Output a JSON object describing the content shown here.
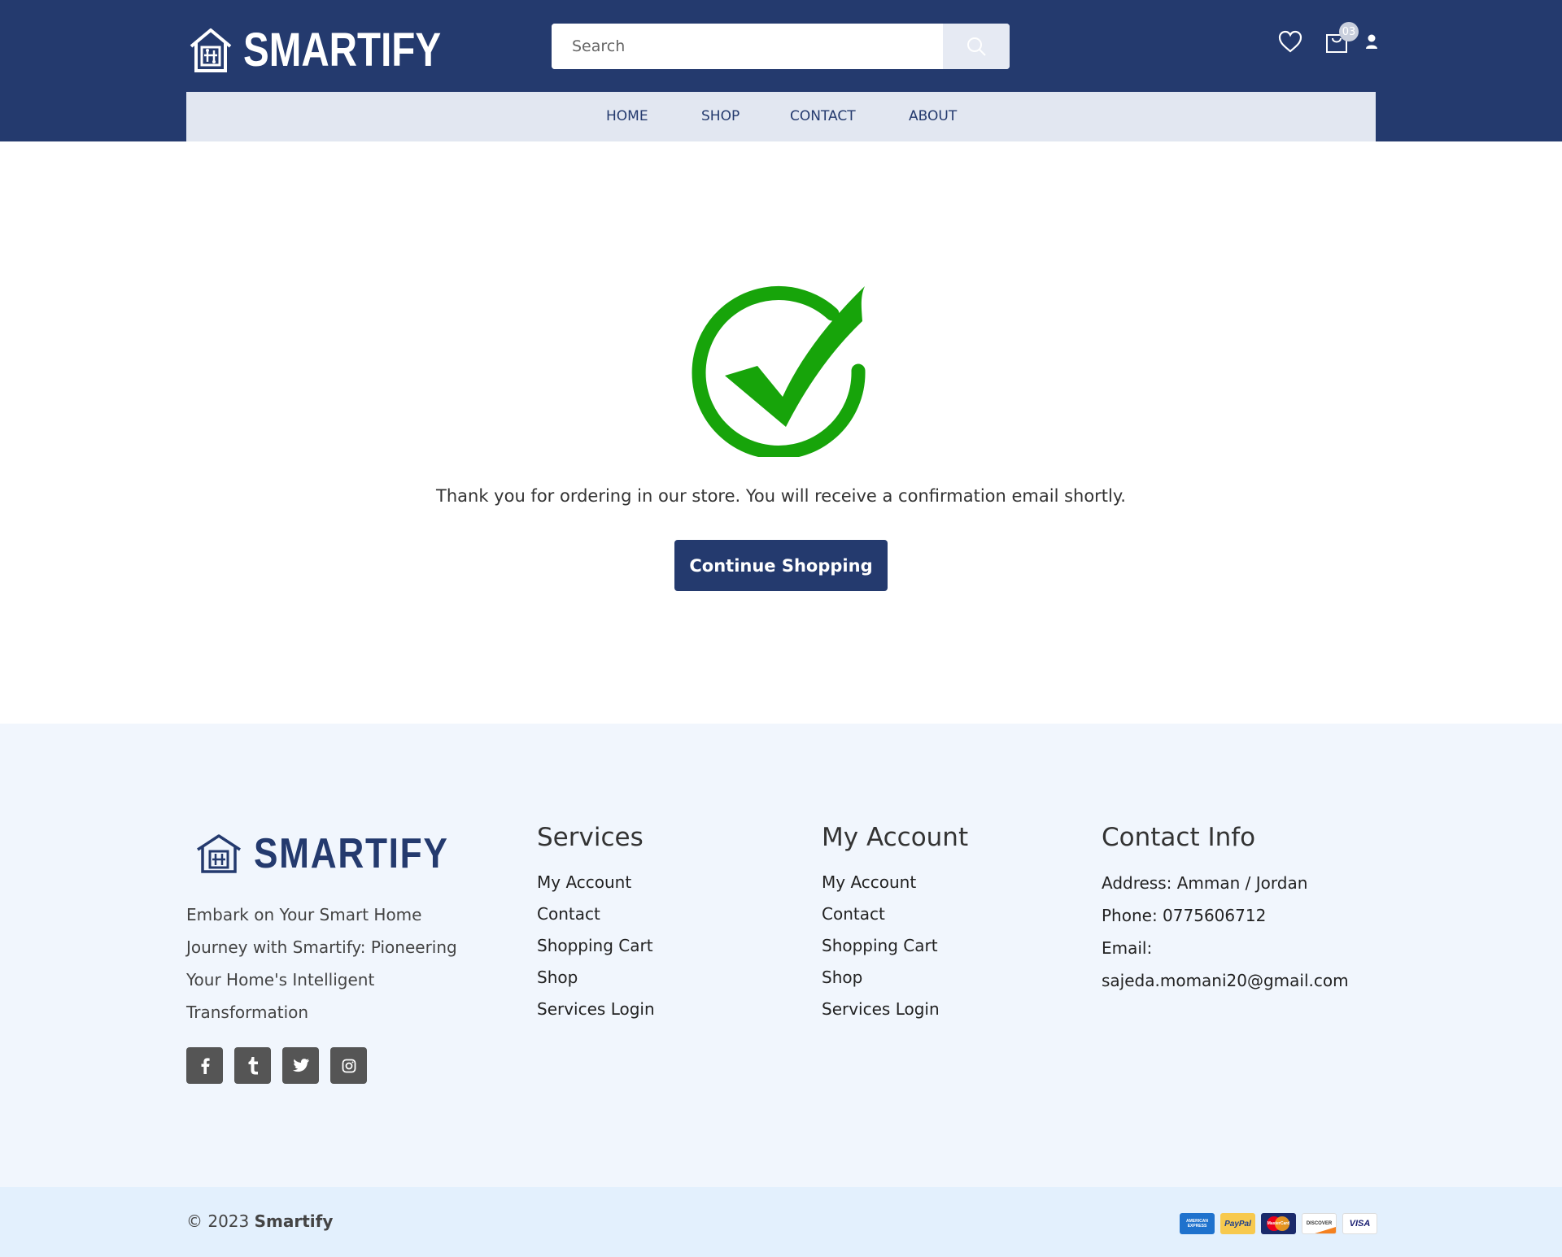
{
  "header": {
    "brand": "SMARTIFY",
    "search_placeholder": "Search",
    "cart_count": "03"
  },
  "nav": {
    "items": [
      {
        "label": "HOME"
      },
      {
        "label": "SHOP"
      },
      {
        "label": "CONTACT"
      },
      {
        "label": "ABOUT"
      }
    ]
  },
  "main": {
    "message": "Thank you for ordering in our store. You will receive a confirmation email shortly.",
    "button_label": "Continue Shopping",
    "check_color": "#17a40a"
  },
  "footer": {
    "brand": "SMARTIFY",
    "about": "Embark on Your Smart Home Journey with Smartify: Pioneering Your Home's Intelligent Transformation",
    "socials": [
      "facebook-icon",
      "tumblr-icon",
      "twitter-icon",
      "instagram-icon"
    ],
    "services": {
      "title": "Services",
      "links": [
        "My Account",
        "Contact",
        "Shopping Cart",
        "Shop",
        "Services Login"
      ]
    },
    "my_account": {
      "title": "My Account",
      "links": [
        "My Account",
        "Contact",
        "Shopping Cart",
        "Shop",
        "Services Login"
      ]
    },
    "contact": {
      "title": "Contact Info",
      "address": "Address: Amman / Jordan",
      "phone": "Phone: 0775606712",
      "email_label": "Email:",
      "email": "sajeda.momani20@gmail.com"
    }
  },
  "bottom": {
    "copyright_prefix": "© 2023",
    "copyright_brand": "Smartify",
    "payment_cards": [
      "AMERICAN EXPRESS",
      "PayPal",
      "MasterCard",
      "DISCOVER",
      "VISA"
    ]
  },
  "colors": {
    "primary": "#243a6e",
    "nav_bg": "#e2e7f1",
    "footer_bg": "#f1f6fd",
    "bottom_bg": "#e3f0fd"
  }
}
